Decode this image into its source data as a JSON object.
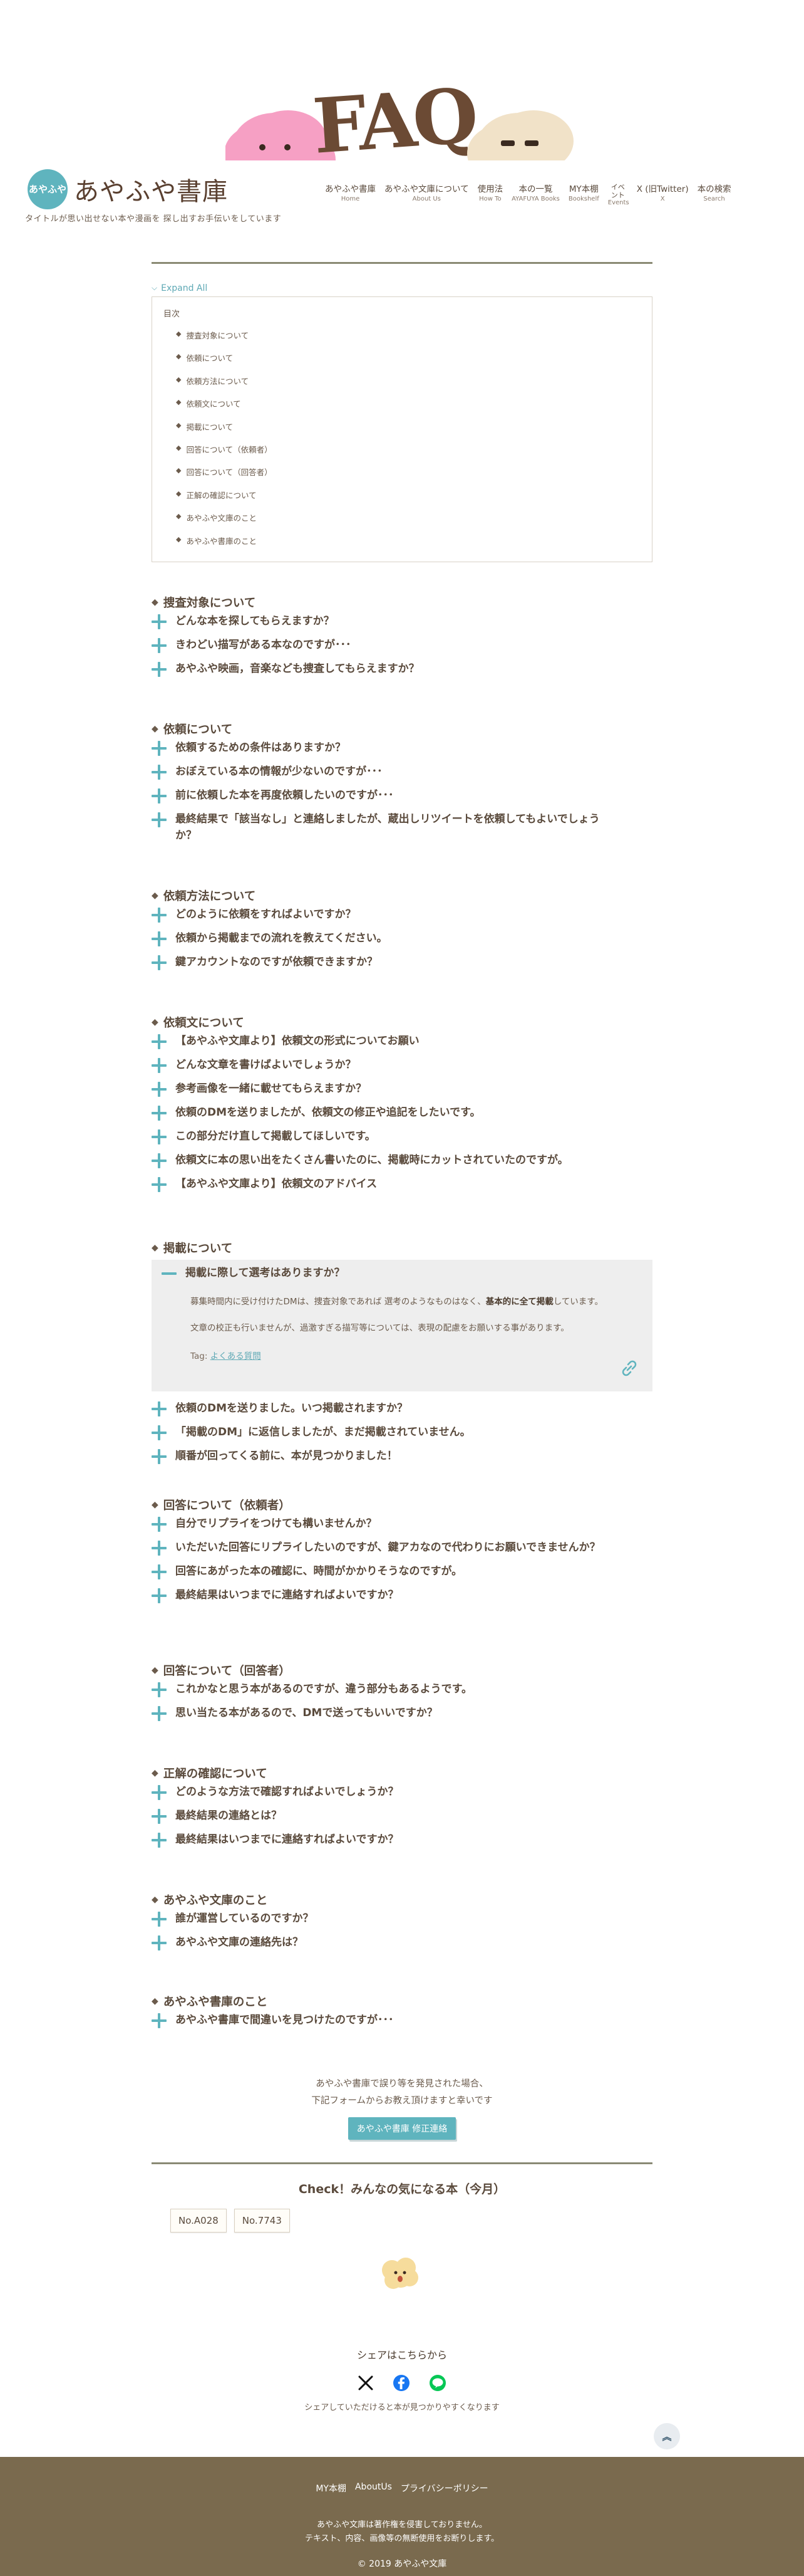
{
  "site": {
    "logo_mark": "あやふや",
    "logo_text": "あやふや書庫",
    "tagline": "タイトルが思い出せない本や漫画を 探し出すお手伝いをしています",
    "hero_text": "FAQ"
  },
  "nav": [
    {
      "jp": "あやふや書庫",
      "en": "Home"
    },
    {
      "jp": "あやふや文庫について",
      "en": "About Us"
    },
    {
      "jp": "使用法",
      "en": "How To"
    },
    {
      "jp": "本の一覧",
      "en": "AYAFUYA Books"
    },
    {
      "jp": "MY本棚",
      "en": "Bookshelf"
    },
    {
      "jp": "イベント",
      "en": "Events"
    },
    {
      "jp": "X (旧Twitter)",
      "en": "X"
    },
    {
      "jp": "本の検索",
      "en": "Search"
    }
  ],
  "expand_all": "Expand All",
  "toc": {
    "title": "目次",
    "items": [
      "捜査対象について",
      "依頼について",
      "依頼方法について",
      "依頼文について",
      "掲載について",
      "回答について（依頼者）",
      "回答について（回答者）",
      "正解の確認について",
      "あやふや文庫のこと",
      "あやふや書庫のこと"
    ]
  },
  "sections": [
    {
      "title": "捜査対象について",
      "questions": [
        "どんな本を探してもらえますか？",
        "きわどい描写がある本なのですが･･･",
        "あやふや映画，音楽なども捜査してもらえますか？"
      ]
    },
    {
      "title": "依頼について",
      "questions": [
        "依頼するための条件はありますか？",
        "おぼえている本の情報が少ないのですが･･･",
        "前に依頼した本を再度依頼したいのですが･･･",
        "最終結果で「該当なし」と連絡しましたが、蔵出しリツイートを依頼してもよいでしょうか？"
      ]
    },
    {
      "title": "依頼方法について",
      "questions": [
        "どのように依頼をすればよいですか？",
        "依頼から掲載までの流れを教えてください。",
        "鍵アカウントなのですが依頼できますか？"
      ]
    },
    {
      "title": "依頼文について",
      "questions": [
        "【あやふや文庫より】依頼文の形式についてお願い",
        "どんな文章を書けばよいでしょうか？",
        "参考画像を一緒に載せてもらえますか？",
        "依頼のDMを送りましたが、依頼文の修正や追記をしたいです。",
        "この部分だけ直して掲載してほしいです。",
        "依頼文に本の思い出をたくさん書いたのに、掲載時にカットされていたのですが。",
        "【あやふや文庫より】依頼文のアドバイス"
      ]
    },
    {
      "title": "掲載について",
      "open_question": "掲載に際して選考はありますか？",
      "answer_1_pre": "募集時間内に受け付けたDMは、捜査対象であれば 選考のようなものはなく、",
      "answer_1_bold": "基本的に全て掲載",
      "answer_1_post": "しています。",
      "answer_2": "文章の校正も行いませんが、過激すぎる描写等については、表現の配慮をお願いする事があります。",
      "tags_label": "Tag:",
      "tag": "よくある質問",
      "questions": [
        "依頼のDMを送りました。いつ掲載されますか？",
        "「掲載のDM」に返信しましたが、まだ掲載されていません。",
        "順番が回ってくる前に、本が見つかりました！"
      ]
    },
    {
      "title": "回答について（依頼者）",
      "questions": [
        "自分でリプライをつけても構いませんか？",
        "いただいた回答にリプライしたいのですが、鍵アカなので代わりにお願いできませんか？",
        "回答にあがった本の確認に、時間がかかりそうなのですが。",
        "最終結果はいつまでに連絡すればよいですか？"
      ]
    },
    {
      "title": "回答について（回答者）",
      "questions": [
        "これかなと思う本があるのですが、違う部分もあるようです。",
        "思い当たる本があるので、DMで送ってもいいですか？"
      ]
    },
    {
      "title": "正解の確認について",
      "questions": [
        "どのような方法で確認すればよいでしょうか？",
        "最終結果の連絡とは？",
        "最終結果はいつまでに連絡すればよいですか？"
      ]
    },
    {
      "title": "あやふや文庫のこと",
      "questions": [
        "誰が運営しているのですか？",
        "あやふや文庫の連絡先は？"
      ]
    },
    {
      "title": "あやふや書庫のこと",
      "questions": [
        "あやふや書庫で間違いを見つけたのですが･･･"
      ]
    }
  ],
  "report": {
    "line1": "あやふや書庫で誤り等を発見された場合、",
    "line2": "下記フォームからお教え頂けますと幸いです",
    "button": "あやふや書庫 修正連絡"
  },
  "check": {
    "title": "Check！みんなの気になる本（今月）",
    "items": [
      "No.A028",
      "No.7743"
    ]
  },
  "share": {
    "title": "シェアはこちらから",
    "note": "シェアしていただけると本が見つかりやすくなります"
  },
  "footer": {
    "links": [
      "MY本棚",
      "AboutUs",
      "プライバシーポリシー"
    ],
    "note_1": "あやふや文庫は著作権を侵害しておりません。",
    "note_2": "テキスト、内容、画像等の無断使用をお断りします。",
    "copyright": "© 2019 あやふや文庫"
  },
  "colors": {
    "accent": "#5fb4be",
    "text": "#5a4a3c",
    "footer_bg": "#7a6a4e"
  }
}
